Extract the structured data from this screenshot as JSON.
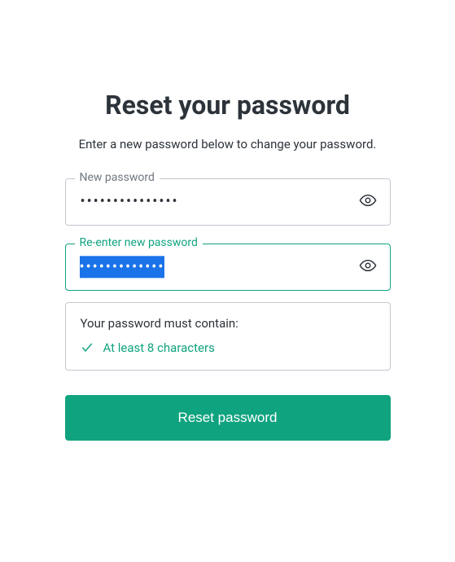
{
  "title": "Reset your password",
  "subtitle": "Enter a new password below to change your password.",
  "fields": {
    "new_password": {
      "label": "New password",
      "mask": "•••••••••••••••"
    },
    "confirm_password": {
      "label": "Re-enter new password",
      "mask": "•••••••••••••"
    }
  },
  "rules": {
    "title": "Your password must contain:",
    "items": [
      {
        "text": "At least 8 characters",
        "met": true
      }
    ]
  },
  "submit_label": "Reset password",
  "colors": {
    "accent": "#10a37f",
    "border": "#c2c8d0",
    "text": "#2d333a",
    "selection": "#1a73e8"
  }
}
